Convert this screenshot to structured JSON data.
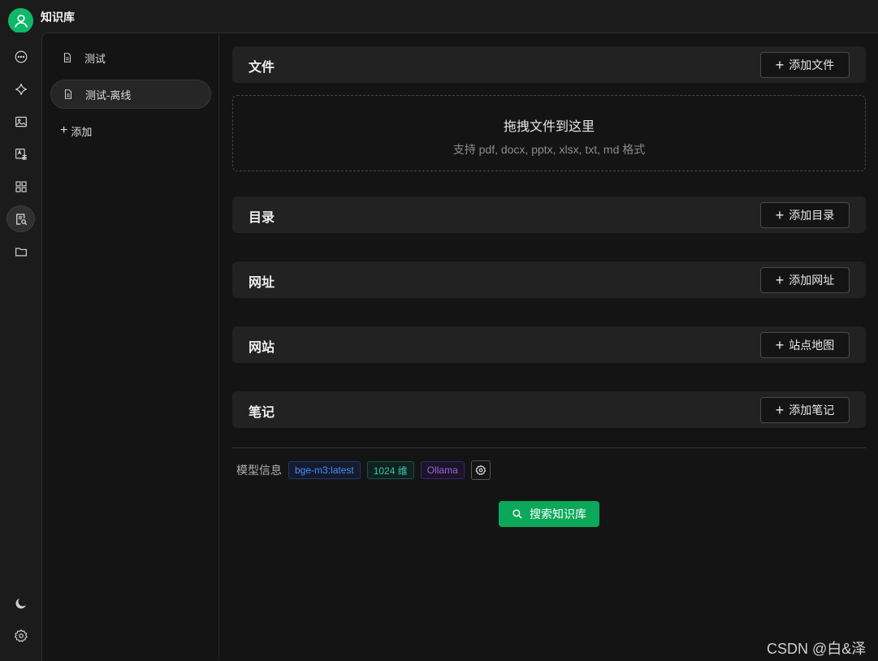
{
  "app": {
    "title": "知识库"
  },
  "rail": {
    "items": [
      {
        "icon": "chat-icon"
      },
      {
        "icon": "sparkle-icon"
      },
      {
        "icon": "image-icon"
      },
      {
        "icon": "translate-icon"
      },
      {
        "icon": "apps-icon"
      },
      {
        "icon": "knowledge-base-icon",
        "active": true
      },
      {
        "icon": "folder-icon"
      }
    ],
    "bottom": [
      {
        "icon": "moon-icon"
      },
      {
        "icon": "gear-icon"
      }
    ]
  },
  "knowledge_bases": {
    "items": [
      {
        "label": "测试"
      },
      {
        "label": "测试-离线",
        "selected": true
      }
    ],
    "add_label": "添加"
  },
  "sections": {
    "file": {
      "title": "文件",
      "button": "添加文件"
    },
    "dropzone": {
      "title": "拖拽文件到这里",
      "subtitle": "支持 pdf, docx, pptx, xlsx, txt, md 格式"
    },
    "directory": {
      "title": "目录",
      "button": "添加目录"
    },
    "url": {
      "title": "网址",
      "button": "添加网址"
    },
    "website": {
      "title": "网站",
      "button": "站点地图"
    },
    "notes": {
      "title": "笔记",
      "button": "添加笔记"
    }
  },
  "model_info": {
    "label": "模型信息",
    "tags": [
      "bge-m3:latest",
      "1024 维",
      "Ollama"
    ]
  },
  "search_button": "搜索知识库",
  "watermark": "CSDN @白&泽",
  "colors": {
    "accent": "#0aa858",
    "avatar": "#0fb868"
  }
}
